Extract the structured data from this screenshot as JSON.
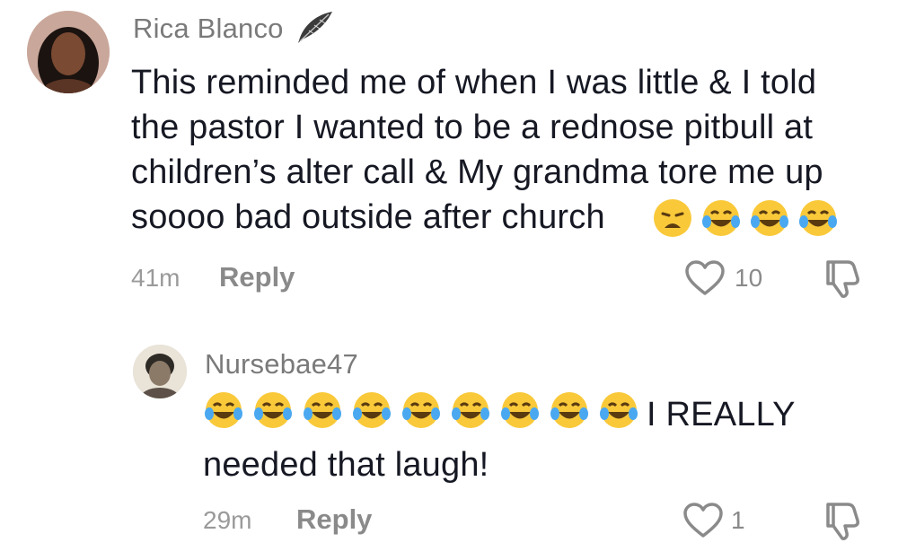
{
  "comments": [
    {
      "username": "Rica Blanco",
      "badge_icon": "feather-icon",
      "text": "This reminded me of when I was little & I told the pastor I wanted to be a rednose pitbull at children’s alter call & My grandma tore me up soooo bad outside after church",
      "text_lines": [
        "This reminded me of when I was little & I told",
        "the pastor I wanted to be a rednose pitbull at",
        "children’s alter call & My grandma tore me up",
        "soooo bad outside after church"
      ],
      "emojis": [
        "weary-face-emoji",
        "face-with-tears-of-joy-emoji",
        "face-with-tears-of-joy-emoji",
        "face-with-tears-of-joy-emoji"
      ],
      "time": "41m",
      "reply_label": "Reply",
      "likes": "10"
    },
    {
      "username": "Nursebae47",
      "emojis_count": 9,
      "emoji_icon": "face-with-tears-of-joy-emoji",
      "text_after_emojis": "I REALLY",
      "text_line2": "needed that laugh!",
      "time": "29m",
      "reply_label": "Reply",
      "likes": "1"
    }
  ],
  "colors": {
    "username": "#7a7a7a",
    "text": "#161823",
    "meta": "#9a9a9a"
  }
}
